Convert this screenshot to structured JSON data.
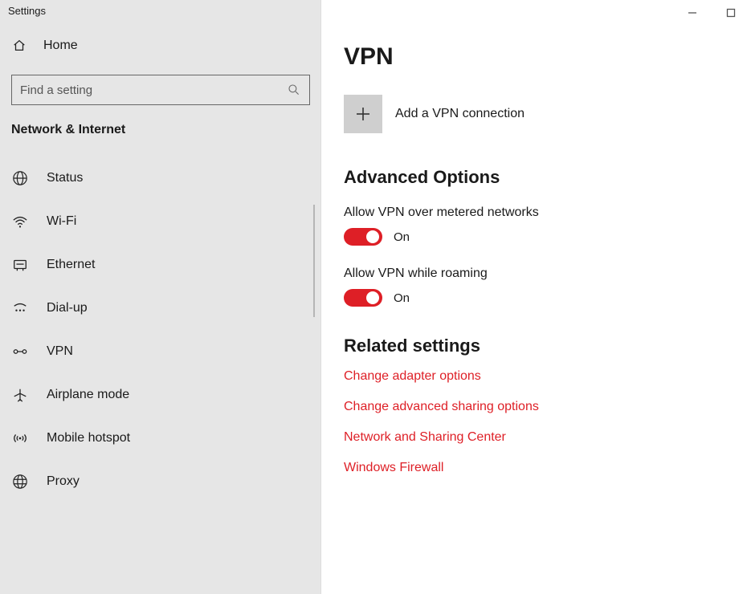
{
  "app_title": "Settings",
  "sidebar": {
    "home_label": "Home",
    "search_placeholder": "Find a setting",
    "category": "Network & Internet",
    "items": [
      {
        "label": "Status"
      },
      {
        "label": "Wi-Fi"
      },
      {
        "label": "Ethernet"
      },
      {
        "label": "Dial-up"
      },
      {
        "label": "VPN"
      },
      {
        "label": "Airplane mode"
      },
      {
        "label": "Mobile hotspot"
      },
      {
        "label": "Proxy"
      }
    ]
  },
  "main": {
    "page_title": "VPN",
    "add_vpn_label": "Add a VPN connection",
    "advanced_heading": "Advanced Options",
    "settings": [
      {
        "label": "Allow VPN over metered networks",
        "state": "On"
      },
      {
        "label": "Allow VPN while roaming",
        "state": "On"
      }
    ],
    "related_heading": "Related settings",
    "links": [
      "Change adapter options",
      "Change advanced sharing options",
      "Network and Sharing Center",
      "Windows Firewall"
    ]
  },
  "colors": {
    "accent": "#de1f26"
  }
}
